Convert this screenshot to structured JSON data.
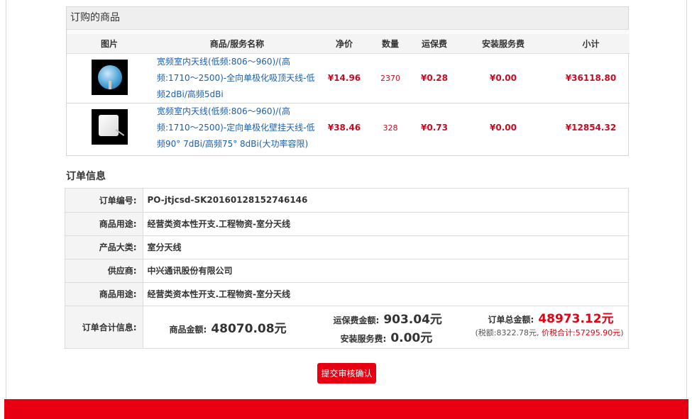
{
  "products": {
    "title": "订购的商品",
    "headers": {
      "image": "图片",
      "name": "商品/服务名称",
      "price": "净价",
      "qty": "数量",
      "shipping": "运保费",
      "install": "安装服务费",
      "subtotal": "小计"
    },
    "rows": [
      {
        "image_icon": "ceiling-antenna-image",
        "name": "宽频室内天线(低频:806～960)/(高频:1710～2500)-全向单极化吸顶天线-低频2dBi/高频5dBi",
        "price": "¥14.96",
        "qty": "2370",
        "shipping": "¥0.28",
        "install": "¥0.00",
        "subtotal": "¥36118.80"
      },
      {
        "image_icon": "panel-antenna-image",
        "name": "宽频室内天线(低频:806～960)/(高频:1710～2500)-定向单极化壁挂天线-低频90° 7dBi/高频75° 8dBi(大功率容限)",
        "price": "¥38.46",
        "qty": "328",
        "shipping": "¥0.73",
        "install": "¥0.00",
        "subtotal": "¥12854.32"
      }
    ]
  },
  "order_info": {
    "title": "订单信息",
    "rows": [
      {
        "label": "订单编号:",
        "value": "PO-jtjcsd-SK20160128152746146"
      },
      {
        "label": "商品用途:",
        "value": "经营类资本性开支.工程物资-室分天线"
      },
      {
        "label": "产品大类:",
        "value": "室分天线"
      },
      {
        "label": "供应商:",
        "value": "中兴通讯股份有限公司"
      },
      {
        "label": "商品用途:",
        "value": "经营类资本性开支.工程物资-室分天线"
      }
    ],
    "totals": {
      "label": "订单合计信息:",
      "goods_label": "商品金额:",
      "goods_value": "48070.08元",
      "shipping_label": "运保费金额:",
      "shipping_value": "903.04元",
      "service_label": "安装服务费:",
      "service_value": "0.00元",
      "grand_label": "订单总金额:",
      "grand_value": "48973.12元",
      "tax_prefix": "(税额:",
      "tax_value": "8322.78元",
      "tax_sep": ",",
      "total_with_tax_label": "价税合计:",
      "total_with_tax_value": "57295.90",
      "tax_suffix": "元",
      "tax_close": ")"
    }
  },
  "actions": {
    "submit_label": "提交审核确认"
  },
  "colors": {
    "accent": "#e60012",
    "price_red": "#c30d23",
    "link_blue": "#1f5fa8"
  }
}
